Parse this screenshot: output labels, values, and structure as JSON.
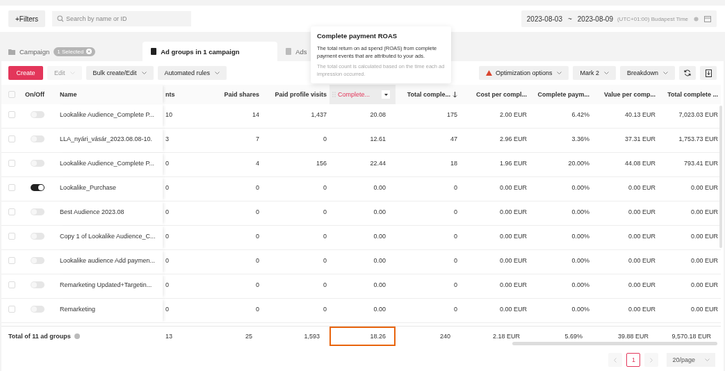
{
  "filters_button": "+Filters",
  "search": {
    "placeholder": "Search by name or ID"
  },
  "date_range": {
    "start": "2023-08-03",
    "separator": "~",
    "end": "2023-08-09",
    "timezone": "(UTC+01:00) Budapest Time"
  },
  "tabs": [
    {
      "label": "Campaign",
      "badge": "1 Selected",
      "selected": false
    },
    {
      "label": "Ad groups in 1 campaign",
      "selected": true
    },
    {
      "label": "Ads",
      "selected": false
    }
  ],
  "tooltip": {
    "title": "Complete payment ROAS",
    "text": "The total return on ad spend (ROAS) from complete payment events that are attributed to your ads.",
    "note": "The total count is calculated based on the time each ad impression occurred."
  },
  "toolbar_left": [
    {
      "label": "Create",
      "kind": "primary",
      "disabled": false
    },
    {
      "label": "Edit",
      "kind": "dropdown",
      "disabled": true
    },
    {
      "label": "Bulk create/Edit",
      "kind": "dropdown",
      "disabled": false
    },
    {
      "label": "Automated rules",
      "kind": "dropdown",
      "disabled": false
    }
  ],
  "toolbar_right": [
    {
      "label": "Optimization options",
      "kind": "warning"
    },
    {
      "label": "Mark 2",
      "kind": "dropdown"
    },
    {
      "label": "Breakdown",
      "kind": "dropdown"
    },
    {
      "kind": "refresh"
    },
    {
      "kind": "export"
    }
  ],
  "table": {
    "select_all_checked": false,
    "toggle_header": "On/Off",
    "columns": [
      {
        "label": "Name",
        "active": false,
        "sorted": false
      },
      {
        "label": "nts",
        "active": false,
        "sorted": false
      },
      {
        "label": "Paid shares",
        "active": false,
        "sorted": false
      },
      {
        "label": "Paid profile visits",
        "active": false,
        "sorted": false
      },
      {
        "label": "Complete...",
        "active": true,
        "sorted": false
      },
      {
        "label": "Total comple...",
        "active": false,
        "sorted": true
      },
      {
        "label": "Cost per compl...",
        "active": false,
        "sorted": false
      },
      {
        "label": "Complete paym...",
        "active": false,
        "sorted": false
      },
      {
        "label": "Value per comp...",
        "active": false,
        "sorted": false
      },
      {
        "label": "Total complete ...",
        "active": false,
        "sorted": false
      }
    ],
    "rows": [
      {
        "checked": false,
        "on": false,
        "cells": [
          "Lookalike Audience_Complete P...",
          "10",
          "14",
          "1,437",
          "20.08",
          "175",
          "2.00 EUR",
          "6.42%",
          "40.13 EUR",
          "7,023.03 EUR"
        ]
      },
      {
        "checked": false,
        "on": false,
        "cells": [
          "LLA_nyári_vásár_2023.08.08-10.",
          "3",
          "7",
          "0",
          "12.61",
          "47",
          "2.96 EUR",
          "3.36%",
          "37.31 EUR",
          "1,753.73 EUR"
        ]
      },
      {
        "checked": false,
        "on": false,
        "cells": [
          "Lookalike Audience_Complete P...",
          "0",
          "4",
          "156",
          "22.44",
          "18",
          "1.96 EUR",
          "20.00%",
          "44.08 EUR",
          "793.41 EUR"
        ]
      },
      {
        "checked": false,
        "on": true,
        "cells": [
          "Lookalike_Purchase",
          "0",
          "0",
          "0",
          "0.00",
          "0",
          "0.00 EUR",
          "0.00%",
          "0.00 EUR",
          "0.00 EUR"
        ]
      },
      {
        "checked": false,
        "on": false,
        "cells": [
          "Best Audience 2023.08",
          "0",
          "0",
          "0",
          "0.00",
          "0",
          "0.00 EUR",
          "0.00%",
          "0.00 EUR",
          "0.00 EUR"
        ]
      },
      {
        "checked": false,
        "on": false,
        "cells": [
          "Copy 1 of Lookalike Audience_C...",
          "0",
          "0",
          "0",
          "0.00",
          "0",
          "0.00 EUR",
          "0.00%",
          "0.00 EUR",
          "0.00 EUR"
        ]
      },
      {
        "checked": false,
        "on": false,
        "cells": [
          "Lookalike audience Add paymen...",
          "0",
          "0",
          "0",
          "0.00",
          "0",
          "0.00 EUR",
          "0.00%",
          "0.00 EUR",
          "0.00 EUR"
        ]
      },
      {
        "checked": false,
        "on": false,
        "cells": [
          "Remarketing Updated+Targetin...",
          "0",
          "0",
          "0",
          "0.00",
          "0",
          "0.00 EUR",
          "0.00%",
          "0.00 EUR",
          "0.00 EUR"
        ]
      },
      {
        "checked": false,
        "on": false,
        "cells": [
          "Remarketing",
          "0",
          "0",
          "0",
          "0.00",
          "0",
          "0.00 EUR",
          "0.00%",
          "0.00 EUR",
          "0.00 EUR"
        ]
      }
    ],
    "footer": {
      "label": "Total of 11 ad groups",
      "cells": [
        {
          "value": "13",
          "highlighted": false
        },
        {
          "value": "25",
          "highlighted": false
        },
        {
          "value": "1,593",
          "highlighted": false
        },
        {
          "value": "18.26",
          "highlighted": true
        },
        {
          "value": "240",
          "highlighted": false
        },
        {
          "value": "2.18 EUR",
          "highlighted": false
        },
        {
          "value": "5.69%",
          "highlighted": false
        },
        {
          "value": "39.88 EUR",
          "highlighted": false
        },
        {
          "value": "9,570.18 EUR",
          "highlighted": false
        }
      ]
    }
  },
  "pagination": {
    "pages": [
      {
        "label": "1",
        "selected": true
      }
    ],
    "page_size": "20/page"
  }
}
